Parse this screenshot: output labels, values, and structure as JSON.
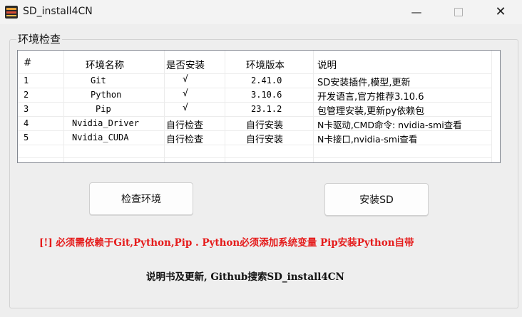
{
  "window": {
    "title": "SD_install4CN",
    "minimize_glyph": "—",
    "close_glyph": "✕"
  },
  "group": {
    "label": "环境检查"
  },
  "table": {
    "headers": [
      "#",
      "环境名称",
      "是否安装",
      "环境版本",
      "说明"
    ],
    "rows": [
      {
        "num": "1",
        "name": "Git",
        "installed": "√",
        "version": "2.41.0",
        "desc": "SD安装插件,模型,更新"
      },
      {
        "num": "2",
        "name": "Python",
        "installed": "√",
        "version": "3.10.6",
        "desc": "开发语言,官方推荐3.10.6"
      },
      {
        "num": "3",
        "name": "Pip",
        "installed": "√",
        "version": "23.1.2",
        "desc": "包管理安装,更新py依赖包"
      },
      {
        "num": "4",
        "name": "Nvidia_Driver",
        "installed": "自行检查",
        "version": "自行安装",
        "desc": "N卡驱动,CMD命令: nvidia-smi查看"
      },
      {
        "num": "5",
        "name": "Nvidia_CUDA",
        "installed": "自行检查",
        "version": "自行安装",
        "desc": "N卡接口,nvidia-smi查看"
      }
    ]
  },
  "buttons": {
    "check_env": "检查环境",
    "install_sd": "安装SD"
  },
  "warning": "[!] 必须需依赖于Git,Python,Pip . Python必须添加系统变量 Pip安装Python自带",
  "footer_note": "说明书及更新, Github搜索SD_install4CN",
  "colors": {
    "warning": "#e51b1b",
    "window_bg": "#eeeeee",
    "table_bg": "#ffffff"
  }
}
